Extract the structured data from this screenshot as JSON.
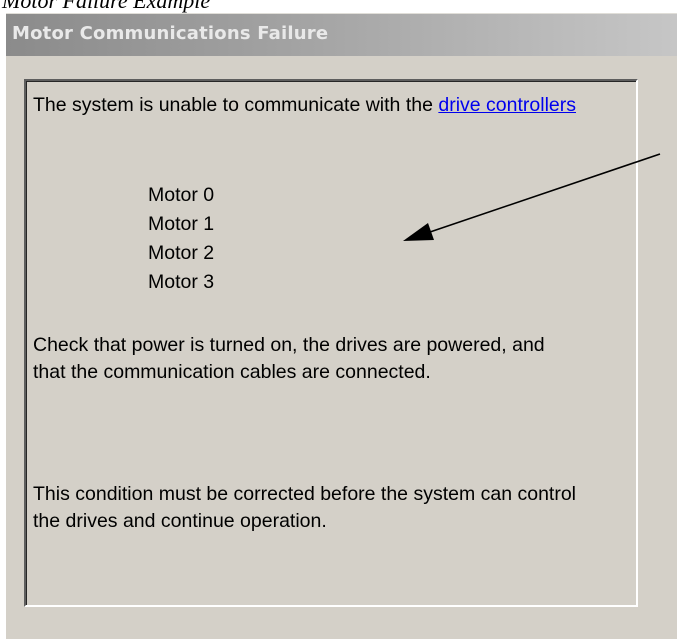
{
  "caption": "Motor Failure Example",
  "dialog": {
    "title": "Motor Communications Failure"
  },
  "message": {
    "intro_text": "The system is unable to communicate with the ",
    "link_text": "drive controllers",
    "motors": [
      "Motor 0",
      "Motor 1",
      "Motor 2",
      "Motor 3"
    ],
    "check_text": "Check that power is turned on, the drives are powered, and that the communication cables are connected.",
    "condition_text": "This condition must be corrected before the system can control the drives and continue operation."
  },
  "colors": {
    "dialog_background": "#d4d0c8",
    "title_bar": "#8b8b8b",
    "title_text": "#e9e9e9",
    "link": "#0000ee",
    "arrow": "#000000"
  }
}
